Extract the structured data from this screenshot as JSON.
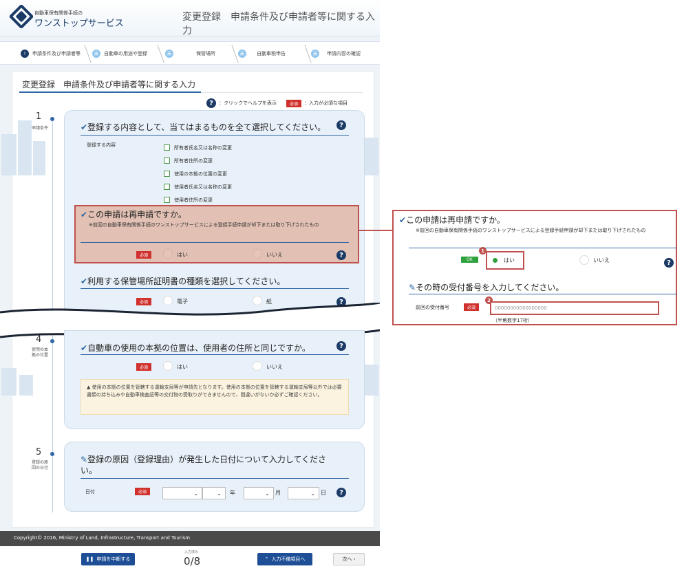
{
  "header": {
    "logo_line1": "自動車保有関係手続の",
    "logo_line2": "ワンストップサービス",
    "page_title": "変更登録　申請条件及び申請者等に関する入力"
  },
  "steps": [
    {
      "num": "!",
      "label": "申請条件及び申請者等"
    },
    {
      "num": "未",
      "label": "自動車の用途や登録"
    },
    {
      "num": "未",
      "label": "保管場所"
    },
    {
      "num": "未",
      "label": "自動車税申告"
    },
    {
      "num": "未",
      "label": "申請内容の確認"
    }
  ],
  "card": {
    "title": "変更登録　申請条件及び申請者等に関する入力",
    "help_text": "：クリックでヘルプを表示",
    "req_label": "必須",
    "req_text": "：入力が必須な項目"
  },
  "section1": {
    "num": "1",
    "label": "申請条件",
    "q1_title": "登録する内容として、当てはまるものを全て選択してください。",
    "field_label": "登録する内容",
    "options": [
      "所有者氏名又は名称の変更",
      "所有者住所の変更",
      "使用の本拠の位置の変更",
      "使用者氏名又は名称の変更",
      "使用者住所の変更"
    ],
    "q2_title": "この申請は再申請ですか。",
    "q2_note": "※前回の自動車保有関係手続のワンストップサービスによる登録手続申請が却下または取り下げされたもの",
    "q2_yes": "はい",
    "q2_no": "いいえ",
    "q3_title": "利用する保管場所証明書の種類を選択してください。",
    "q3_opt1": "電子",
    "q3_opt2": "紙"
  },
  "section4": {
    "num": "4",
    "label1": "使用の本",
    "label2": "拠の位置",
    "q_title": "自動車の使用の本拠の位置は、使用者の住所と同じですか。",
    "yes": "はい",
    "no": "いいえ",
    "warning": "▲ 使用の本拠の位置を管轄する運輸支局等が申請先となります。使用の本拠の位置を管轄する運輸支局等以外では必要書類の持ち込みや自動車検査証等の交付物の受取りができませんので、間違いがないか必ずご確認ください。"
  },
  "section5": {
    "num": "5",
    "label1": "登録の原",
    "label2": "因の日付",
    "q_title": "登録の原因（登録理由）が発生した日付について入力してください。",
    "field_label": "日付",
    "year": "年",
    "month": "月",
    "day": "日"
  },
  "footer": {
    "copyright": "Copyright© 2016, Ministry of Land, Infrastructure, Transport and Tourism"
  },
  "bottom": {
    "pause_button": "申請を中断する",
    "progress_label": "入力済み",
    "progress_value": "0/8",
    "missing_button": "入力不備項目へ",
    "next_button": "次へ ›"
  },
  "zoom": {
    "q_title": "この申請は再申請ですか。",
    "q_note": "※前回の自動車保有関係手続のワンストップサービスによる登録手続申請が却下または取り下げされたもの",
    "ok": "OK",
    "yes": "はい",
    "no": "いいえ",
    "q2_title": "その時の受付番号を入力してください。",
    "field_label": "前回の受付番号",
    "placeholder": "00000000000000000",
    "hint": "（半角数字17桁）",
    "badge1": "1",
    "badge2": "2"
  },
  "colors": {
    "accent": "#2f66a4",
    "highlight": "#c0504d",
    "required": "#d0312d",
    "ok": "#2fa13c"
  }
}
